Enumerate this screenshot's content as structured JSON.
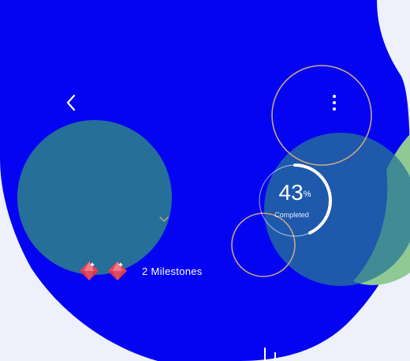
{
  "colors": {
    "background": "#eef0fb",
    "primary_blue": "#0404f3",
    "teal_circle": "#277594",
    "green_shape": "#8fca95",
    "ring_outline": "#c9a784",
    "progress_arc": "#ffffff",
    "gem": "#e8445a"
  },
  "header": {
    "back_icon": "chevron-left-icon",
    "menu_icon": "vertical-ellipsis-icon"
  },
  "progress": {
    "value": "43",
    "unit": "%",
    "caption": "Completed",
    "fraction": 0.43
  },
  "milestones": {
    "icon": "gem-icon",
    "label": "2 Milestones"
  }
}
